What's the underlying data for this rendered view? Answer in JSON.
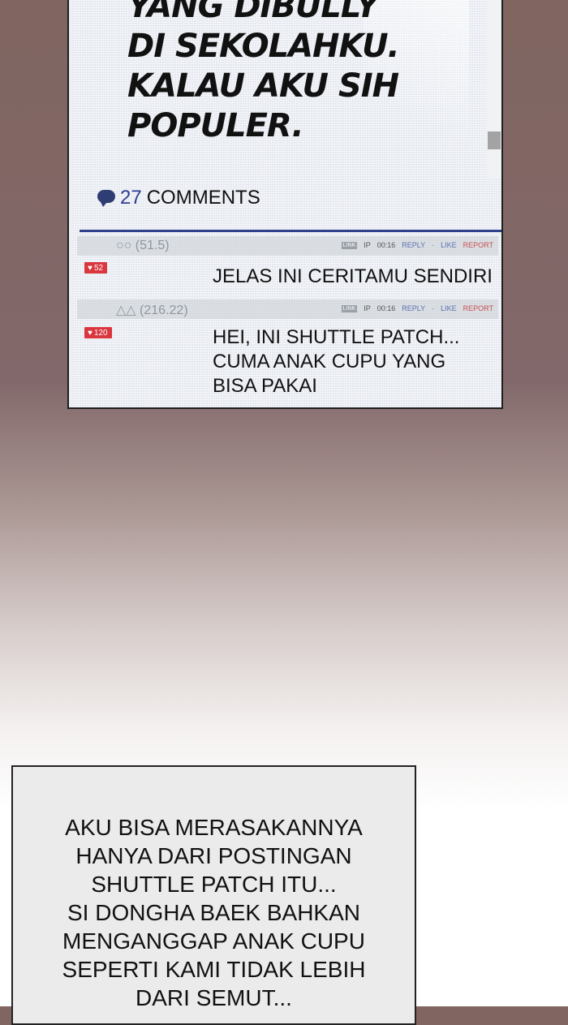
{
  "post": {
    "lines": [
      "YANG DIBULLY",
      "DI SEKOLAHKU.",
      "KALAU AKU SIH",
      "POPULER."
    ]
  },
  "comments_header": {
    "count": "27",
    "label": "COMMENTS",
    "icon": "speech-bubble-icon"
  },
  "comments": [
    {
      "name": "○○ (51.5)",
      "badge": "LINK",
      "ip": "IP",
      "time": "00:16",
      "reply": "REPLY",
      "like": "LIKE",
      "report": "REPORT",
      "likes": "52",
      "text_lines": [
        "JELAS INI CERITAMU SENDIRI"
      ]
    },
    {
      "name": "△△ (216.22)",
      "badge": "LINK",
      "ip": "IP",
      "time": "00:16",
      "reply": "REPLY",
      "like": "LIKE",
      "report": "REPORT",
      "likes": "120",
      "text_lines": [
        "HEI, INI SHUTTLE PATCH...",
        "CUMA ANAK CUPU YANG",
        "BISA PAKAI"
      ]
    }
  ],
  "narration": {
    "lines": [
      "AKU BISA MERASAKANNYA",
      "HANYA DARI POSTINGAN",
      "SHUTTLE PATCH ITU...",
      "SI DONGHA BAEK BAHKAN",
      "MENGANGGAP ANAK CUPU",
      "SEPERTI KAMI TIDAK LEBIH",
      "DARI SEMUT..."
    ]
  },
  "colors": {
    "accent_blue": "#30418b",
    "heart_red": "#d9363e",
    "report_red": "#c84e4e"
  }
}
